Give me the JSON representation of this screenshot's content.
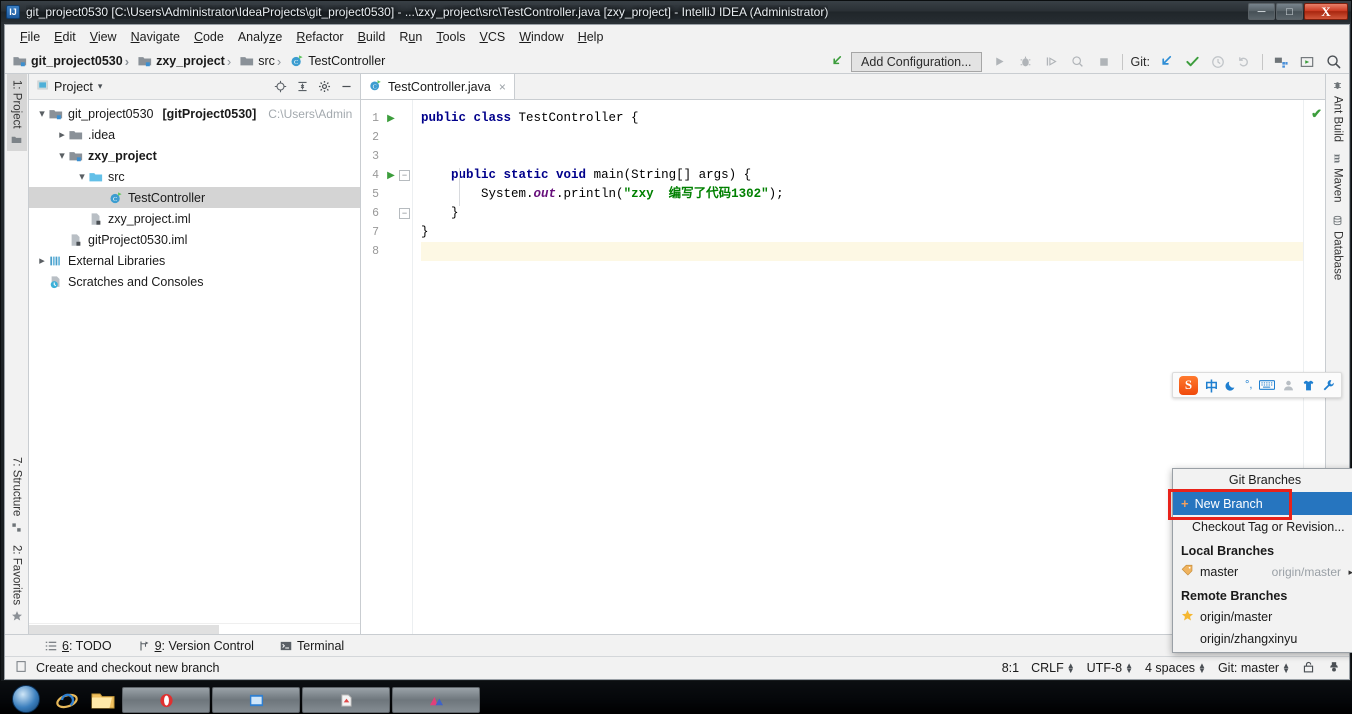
{
  "window": {
    "title": "git_project0530 [C:\\Users\\Administrator\\IdeaProjects\\git_project0530] - ...\\zxy_project\\src\\TestController.java [zxy_project] - IntelliJ IDEA (Administrator)",
    "app_icon": "IJ",
    "buttons": {
      "minimize": "─",
      "maximize": "□",
      "close": "X"
    }
  },
  "menubar": {
    "items": [
      {
        "label": "File",
        "mnemonic": "F"
      },
      {
        "label": "Edit",
        "mnemonic": "E"
      },
      {
        "label": "View",
        "mnemonic": "V"
      },
      {
        "label": "Navigate",
        "mnemonic": "N"
      },
      {
        "label": "Code",
        "mnemonic": "C"
      },
      {
        "label": "Analyze",
        "mnemonic": "z"
      },
      {
        "label": "Refactor",
        "mnemonic": "R"
      },
      {
        "label": "Build",
        "mnemonic": "B"
      },
      {
        "label": "Run",
        "mnemonic": "u"
      },
      {
        "label": "Tools",
        "mnemonic": "T"
      },
      {
        "label": "VCS",
        "mnemonic": "V"
      },
      {
        "label": "Window",
        "mnemonic": "W"
      },
      {
        "label": "Help",
        "mnemonic": "H"
      }
    ]
  },
  "navbar": {
    "crumbs": [
      {
        "label": "git_project0530",
        "icon": "module-icon",
        "bold": true
      },
      {
        "label": "zxy_project",
        "icon": "module-icon",
        "bold": true
      },
      {
        "label": "src",
        "icon": "folder-icon",
        "bold": false
      },
      {
        "label": "TestController",
        "icon": "java-class-icon",
        "bold": false
      }
    ],
    "run_config": "Add Configuration...",
    "git_label": "Git:",
    "icons": [
      "back-arrow-icon",
      "run-icon",
      "debug-icon",
      "run-with-coverage-icon",
      "profile-icon",
      "stop-icon",
      "update-project-icon",
      "commit-icon",
      "history-icon",
      "rollback-icon",
      "project-structure-icon",
      "select-in-icon",
      "search-everywhere-icon"
    ]
  },
  "left_strip": {
    "tabs": [
      {
        "label": "1: Project",
        "mnemonic": "1",
        "icon": "project-icon",
        "active": true
      },
      {
        "label": "7: Structure",
        "mnemonic": "7",
        "icon": "structure-icon",
        "active": false
      },
      {
        "label": "2: Favorites",
        "mnemonic": "2",
        "icon": "favorites-star-icon",
        "active": false
      }
    ]
  },
  "right_strip": {
    "tabs": [
      {
        "label": "Ant Build",
        "icon": "ant-icon"
      },
      {
        "label": "Maven",
        "icon": "maven-icon"
      },
      {
        "label": "Database",
        "icon": "database-icon"
      }
    ]
  },
  "project_panel": {
    "title": "Project",
    "dropdown": "▾",
    "tools": [
      "locate-icon",
      "collapse-all-icon",
      "settings-gear-icon",
      "hide-icon"
    ],
    "tree": [
      {
        "depth": 0,
        "arrow": "down",
        "icon": "module-icon",
        "label": "git_project0530",
        "extra": "[gitProject0530]",
        "path": "C:\\Users\\Admin",
        "bold": false,
        "selected": false
      },
      {
        "depth": 1,
        "arrow": "right",
        "icon": "folder-icon",
        "label": ".idea",
        "extra": "",
        "path": "",
        "bold": false,
        "selected": false
      },
      {
        "depth": 1,
        "arrow": "down",
        "icon": "module-icon",
        "label": "zxy_project",
        "extra": "",
        "path": "",
        "bold": true,
        "selected": false
      },
      {
        "depth": 2,
        "arrow": "down",
        "icon": "source-folder-icon",
        "label": "src",
        "extra": "",
        "path": "",
        "bold": false,
        "selected": false
      },
      {
        "depth": 3,
        "arrow": "none",
        "icon": "java-class-icon",
        "label": "TestController",
        "extra": "",
        "path": "",
        "bold": false,
        "selected": true
      },
      {
        "depth": 2,
        "arrow": "none",
        "icon": "iml-file-icon",
        "label": "zxy_project.iml",
        "extra": "",
        "path": "",
        "bold": false,
        "selected": false
      },
      {
        "depth": 1,
        "arrow": "none",
        "icon": "iml-file-icon",
        "label": "gitProject0530.iml",
        "extra": "",
        "path": "",
        "bold": false,
        "selected": false
      },
      {
        "depth": 0,
        "arrow": "right",
        "icon": "libraries-icon",
        "label": "External Libraries",
        "extra": "",
        "path": "",
        "bold": false,
        "selected": false
      },
      {
        "depth": 0,
        "arrow": "none",
        "icon": "scratches-icon",
        "label": "Scratches and Consoles",
        "extra": "",
        "path": "",
        "bold": false,
        "selected": false
      }
    ]
  },
  "editor": {
    "tabs": [
      {
        "label": "TestController.java",
        "icon": "java-class-icon",
        "close": "×",
        "active": true
      }
    ],
    "inspection_status": "✔",
    "lines": [
      {
        "num": "1",
        "run_marker": true,
        "fold": "",
        "current": false,
        "tokens": [
          {
            "t": "public ",
            "c": "kw"
          },
          {
            "t": "class ",
            "c": "kw"
          },
          {
            "t": "TestController {",
            "c": "plain"
          }
        ],
        "indent": 0
      },
      {
        "num": "2",
        "run_marker": false,
        "fold": "",
        "current": false,
        "tokens": [],
        "indent": 0
      },
      {
        "num": "3",
        "run_marker": false,
        "fold": "",
        "current": false,
        "tokens": [],
        "indent": 0
      },
      {
        "num": "4",
        "run_marker": true,
        "fold": "minus",
        "current": false,
        "tokens": [
          {
            "t": "    ",
            "c": "plain"
          },
          {
            "t": "public ",
            "c": "kw"
          },
          {
            "t": "static ",
            "c": "kw"
          },
          {
            "t": "void ",
            "c": "kw"
          },
          {
            "t": "main(String[] args) {",
            "c": "plain"
          }
        ],
        "indent": 0
      },
      {
        "num": "5",
        "run_marker": false,
        "fold": "",
        "current": false,
        "tokens": [
          {
            "t": "        System.",
            "c": "plain"
          },
          {
            "t": "out",
            "c": "fld"
          },
          {
            "t": ".println(",
            "c": "plain"
          },
          {
            "t": "\"zxy  编写了代码1302\"",
            "c": "str"
          },
          {
            "t": ");",
            "c": "plain"
          }
        ],
        "indent": 0
      },
      {
        "num": "6",
        "run_marker": false,
        "fold": "minus",
        "current": false,
        "tokens": [
          {
            "t": "    }",
            "c": "plain"
          }
        ],
        "indent": 0
      },
      {
        "num": "7",
        "run_marker": false,
        "fold": "",
        "current": false,
        "tokens": [
          {
            "t": "}",
            "c": "plain"
          }
        ],
        "indent": 0
      },
      {
        "num": "8",
        "run_marker": false,
        "fold": "",
        "current": true,
        "tokens": [],
        "indent": 0
      }
    ]
  },
  "git_popup": {
    "title": "Git Branches",
    "new_branch": {
      "label": "New Branch",
      "icon": "plus-icon",
      "selected": true
    },
    "checkout": {
      "label": "Checkout Tag or Revision...",
      "icon": ""
    },
    "local_heading": "Local Branches",
    "local_branches": [
      {
        "name": "master",
        "icon": "branch-tag-icon",
        "remote": "origin/master",
        "arrow": "▸"
      }
    ],
    "remote_heading": "Remote Branches",
    "remote_branches": [
      {
        "name": "origin/master",
        "icon": "star-icon"
      },
      {
        "name": "origin/zhangxinyu",
        "icon": ""
      }
    ]
  },
  "ime_bar": {
    "logo": "S",
    "items": [
      "chinese-mode-icon",
      "moon-icon",
      "punctuation-icon",
      "keyboard-icon",
      "user-icon",
      "skin-icon",
      "tools-wrench-icon"
    ],
    "glyphs": [
      "中",
      "☾",
      "°,",
      "⌨",
      "●",
      "▲",
      "⚒"
    ]
  },
  "tool_windows": {
    "items": [
      {
        "label": "6: TODO",
        "mnemonic": "6",
        "icon": "todo-icon"
      },
      {
        "label": "9: Version Control",
        "mnemonic": "9",
        "icon": "version-control-icon"
      },
      {
        "label": "Terminal",
        "mnemonic": "",
        "icon": "terminal-icon"
      }
    ]
  },
  "statusbar": {
    "message": "Create and checkout new branch",
    "message_icon": "info-icon",
    "caret": "8:1",
    "line_separator": "CRLF",
    "encoding": "UTF-8",
    "indent": "4 spaces",
    "git_branch": "Git: master",
    "icons": [
      "lock-icon",
      "incognito-hat-icon"
    ]
  },
  "taskbar": {
    "start": "start-orb-icon",
    "pinned": [
      "ie-icon",
      "explorer-icon"
    ],
    "windows": [
      "opera-window",
      "editor-window",
      "pdf-window",
      "app-window"
    ]
  },
  "colors": {
    "accent_selection": "#2675bf",
    "annotation_red": "#e8221a",
    "keyword_blue": "#00008b",
    "string_green": "#008000",
    "field_purple": "#660e7a",
    "current_line": "#fdf8e4",
    "tree_selection": "#d4d4d4"
  }
}
